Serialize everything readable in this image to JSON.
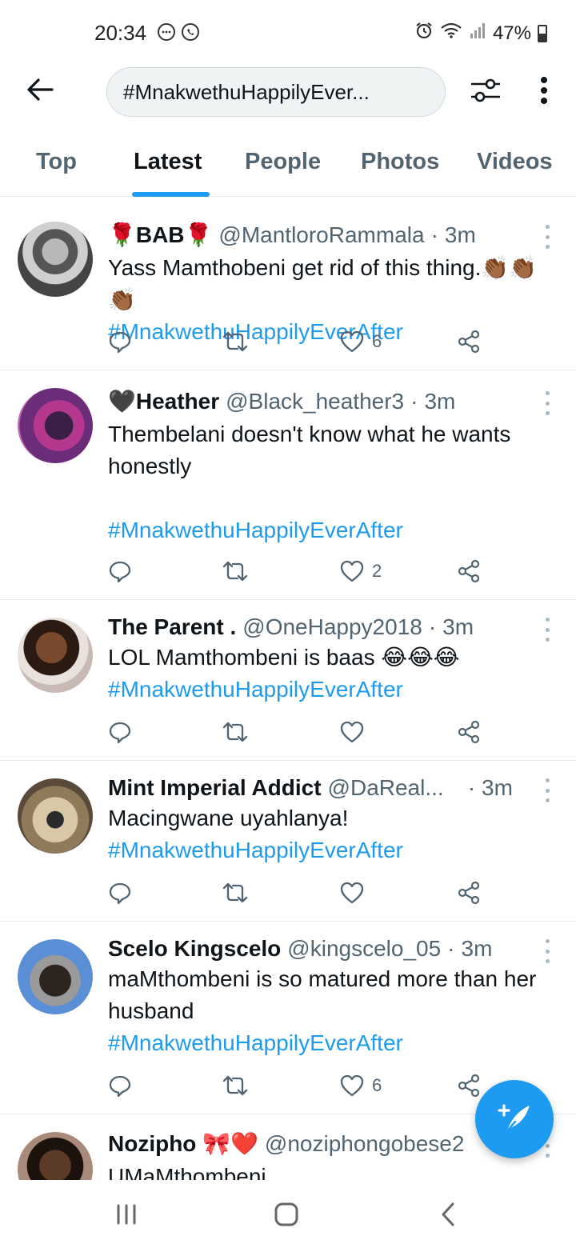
{
  "status_bar": {
    "time": "20:34",
    "battery": "47%",
    "icons": [
      "messages-icon",
      "whatsapp-icon",
      "alarm-icon",
      "wifi-icon",
      "signal-icon",
      "battery-icon"
    ]
  },
  "header": {
    "search_value": "#MnakwethuHappilyEver...",
    "back_icon": "arrow-left-icon",
    "filter_icon": "filter-sliders-icon",
    "more_icon": "more-vertical-icon"
  },
  "tabs": [
    {
      "label": "Top",
      "active": false
    },
    {
      "label": "Latest",
      "active": true
    },
    {
      "label": "People",
      "active": false
    },
    {
      "label": "Photos",
      "active": false
    },
    {
      "label": "Videos",
      "active": false
    }
  ],
  "tweets": [
    {
      "name": "🌹BAB🌹",
      "handle": "@MantloroRammala",
      "time": "3m",
      "text": "Yass Mamthobeni get rid of this thing.👏🏾👏🏾👏🏾",
      "hashtag": "#MnakwethuHappilyEverAfter",
      "likes": "6"
    },
    {
      "name": "🖤Heather",
      "handle": "@Black_heather3",
      "time": "3m",
      "text": "Thembelani doesn't know what he wants honestly",
      "hashtag": "#MnakwethuHappilyEverAfter",
      "likes": "2"
    },
    {
      "name": "The Parent .",
      "handle": "@OneHappy2018",
      "time": "3m",
      "text": "LOL Mamthombeni is baas 😂😂😂",
      "hashtag": "#MnakwethuHappilyEverAfter",
      "likes": ""
    },
    {
      "name": "Mint Imperial Addict",
      "handle": "@DaReal...",
      "time": "3m",
      "text": "Macingwane uyahlanya!",
      "hashtag": "#MnakwethuHappilyEverAfter",
      "likes": ""
    },
    {
      "name": "Scelo Kingscelo",
      "handle": "@kingscelo_05",
      "time": "3m",
      "text": "maMthombeni is so matured more than her husband",
      "hashtag": "#MnakwethuHappilyEverAfter",
      "likes": "6"
    },
    {
      "name": "Nozipho 🎀❤️",
      "handle": "@noziphongobese2",
      "time": "",
      "text": "UMaMthombeni",
      "hashtag": "",
      "likes": ""
    }
  ],
  "colors": {
    "accent": "#1d9bf0",
    "text_primary": "#0f1419",
    "text_secondary": "#536471",
    "divider": "#e6ecf0"
  }
}
